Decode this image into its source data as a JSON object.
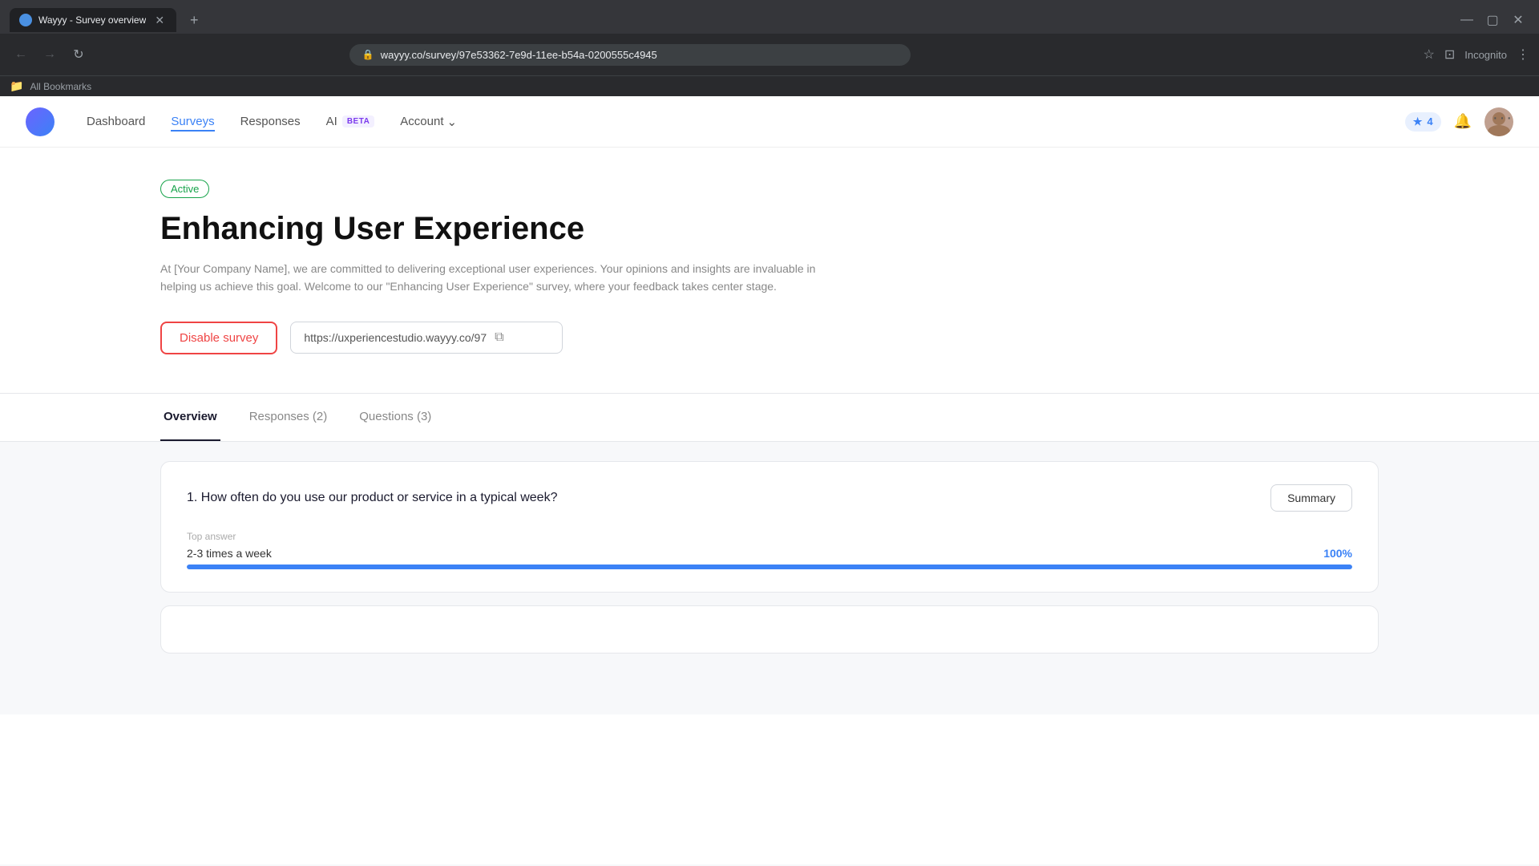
{
  "browser": {
    "tab_title": "Wayyy - Survey overview",
    "url": "wayyy.co/survey/97e53362-7e9d-11ee-b54a-0200555c4945",
    "url_full": "wayyy.co/survey/97e53362-7e9d-11ee-b54a-0200555c4945",
    "bookmarks_label": "All Bookmarks"
  },
  "nav": {
    "dashboard": "Dashboard",
    "surveys": "Surveys",
    "responses": "Responses",
    "ai": "AI",
    "ai_badge": "BETA",
    "account": "Account",
    "notification_count": "4"
  },
  "survey": {
    "status": "Active",
    "title": "Enhancing User Experience",
    "description": "At [Your Company Name], we are committed to delivering exceptional user experiences. Your opinions and insights are invaluable in helping us achieve this goal. Welcome to our \"Enhancing User Experience\" survey, where your feedback takes center stage.",
    "disable_label": "Disable survey",
    "url_display": "https://uxperiencestudio.wayyy.co/97"
  },
  "tabs": [
    {
      "label": "Overview",
      "active": true
    },
    {
      "label": "Responses (2)",
      "active": false
    },
    {
      "label": "Questions (3)",
      "active": false
    }
  ],
  "questions": [
    {
      "number": "1.",
      "text": "How often do you use our product or service in a typical week?",
      "summary_label": "Summary",
      "top_answer_label": "Top answer",
      "top_answer": "2-3 times a week",
      "top_answer_pct": "100%",
      "bar_width": "100"
    }
  ]
}
